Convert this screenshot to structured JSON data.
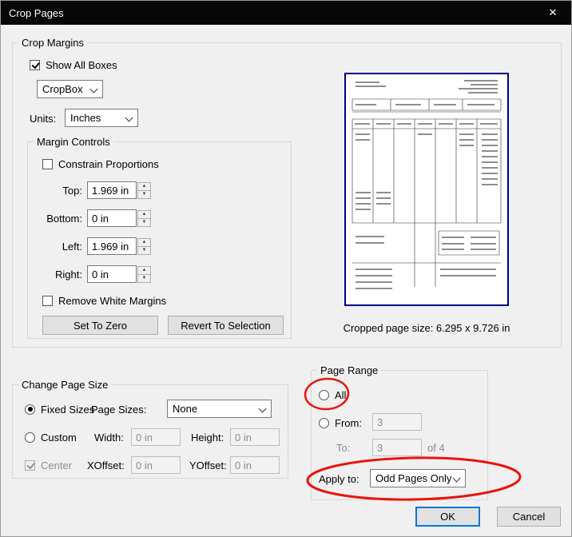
{
  "window": {
    "title": "Crop Pages"
  },
  "icons": {
    "close": "✕",
    "spinner_up": "▲",
    "spinner_down": "▼"
  },
  "crop_margins": {
    "label": "Crop Margins",
    "show_all_boxes_label": "Show All Boxes",
    "box_select_value": "CropBox",
    "units_label": "Units:",
    "units_value": "Inches",
    "margin_controls": {
      "label": "Margin Controls",
      "constrain_label": "Constrain Proportions",
      "rows": [
        {
          "label": "Top:",
          "value": "1.969 in"
        },
        {
          "label": "Bottom:",
          "value": "0 in"
        },
        {
          "label": "Left:",
          "value": "1.969 in"
        },
        {
          "label": "Right:",
          "value": "0 in"
        }
      ],
      "remove_white_margins_label": "Remove White Margins",
      "set_to_zero_label": "Set To Zero",
      "revert_label": "Revert To Selection"
    },
    "cropped_size_text": "Cropped page size: 6.295 x 9.726 in"
  },
  "change_page_size": {
    "label": "Change Page Size",
    "fixed_sizes_label": "Fixed Sizes",
    "page_sizes_label": "Page Sizes:",
    "page_sizes_value": "None",
    "custom_label": "Custom",
    "width_label": "Width:",
    "width_value": "0 in",
    "height_label": "Height:",
    "height_value": "0 in",
    "center_label": "Center",
    "xoffset_label": "XOffset:",
    "xoffset_value": "0 in",
    "yoffset_label": "YOffset:",
    "yoffset_value": "0 in"
  },
  "page_range": {
    "label": "Page Range",
    "all_label": "All",
    "from_label": "From:",
    "from_value": "3",
    "to_label": "To:",
    "to_value": "3",
    "of_label": "of 4",
    "apply_to_label": "Apply to:",
    "apply_to_value": "Odd Pages Only"
  },
  "footer": {
    "ok_label": "OK",
    "cancel_label": "Cancel"
  },
  "colors": {
    "titlebar": "#070707",
    "dialog_bg": "#f0f0f0",
    "focus_border": "#0078d7",
    "annotation_red": "#e8140c",
    "preview_border": "#00008b"
  }
}
